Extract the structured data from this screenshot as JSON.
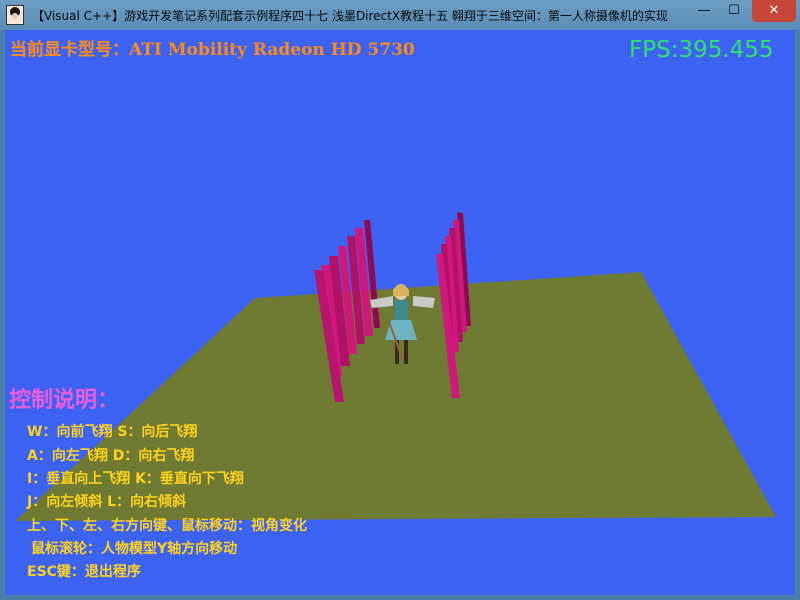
{
  "window": {
    "title": "【Visual C++】游戏开发笔记系列配套示例程序四十七  浅墨DirectX教程十五  翱翔于三维空间：第一人称摄像机的实现",
    "minimize_glyph": "—",
    "maximize_glyph": "☐",
    "close_glyph": "✕"
  },
  "hud": {
    "gpu_label": "当前显卡型号：ATI Mobility Radeon HD 5730",
    "fps_label": "FPS:395.455"
  },
  "help": {
    "title": "控制说明：",
    "lines": [
      "W：向前飞翔     S：向后飞翔",
      "A：向左飞翔     D：向右飞翔",
      "I：垂直向上飞翔     K：垂直向下飞翔",
      "J：向左倾斜       L：向右倾斜",
      "上、下、左、右方向键、鼠标移动：视角变化",
      "鼠标滚轮：人物模型Y轴方向移动",
      "ESC键：退出程序"
    ]
  },
  "scene": {
    "background_color": "#3d63f4",
    "ground_color": "#6f7a32",
    "pillar_color": "#d0187c",
    "pillar_dark_color": "#8e0a52",
    "character": "female-character-model"
  }
}
